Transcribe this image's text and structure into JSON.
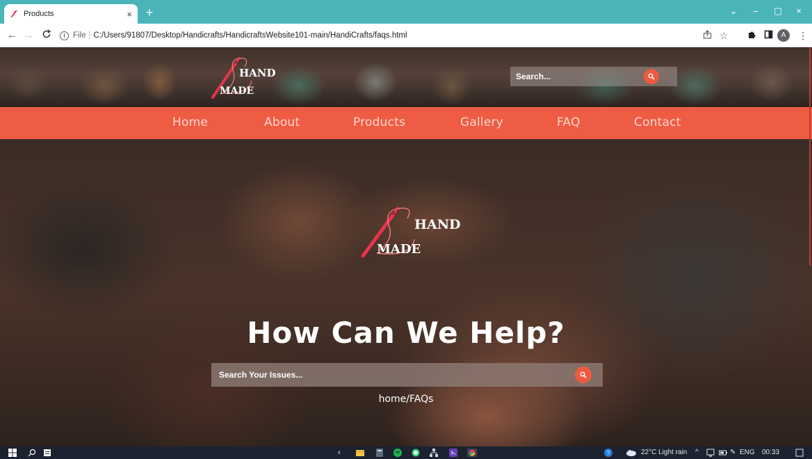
{
  "browser": {
    "tab_title": "Products",
    "tab_close": "×",
    "new_tab": "+",
    "url_scheme": "File",
    "url_separator": "|",
    "url_path": "C:/Users/91807/Desktop/Handicrafts/HandicraftsWebsite101-main/HandiCrafts/faqs.html",
    "profile_initial": "A",
    "window_controls": {
      "chevron": "⌄",
      "minimize": "–",
      "restore": "▢",
      "close": "×"
    }
  },
  "site": {
    "logo": {
      "word_top": "HAND",
      "word_bottom": "MADE"
    },
    "header_search": {
      "placeholder": "Search..."
    },
    "nav": [
      "Home",
      "About",
      "Products",
      "Gallery",
      "FAQ",
      "Contact"
    ],
    "hero": {
      "logo": {
        "word_top": "HAND",
        "word_bottom": "MADE"
      },
      "title": "How Can We Help?",
      "search_placeholder": "Search Your Issues...",
      "breadcrumb": "home/FAQs"
    }
  },
  "taskbar": {
    "weather": "22°C  Light rain",
    "language": "ENG",
    "time": "00:33"
  },
  "colors": {
    "accent": "#ef5c44",
    "browser_frame": "#4ab5b9",
    "needle": "#e8334d"
  }
}
